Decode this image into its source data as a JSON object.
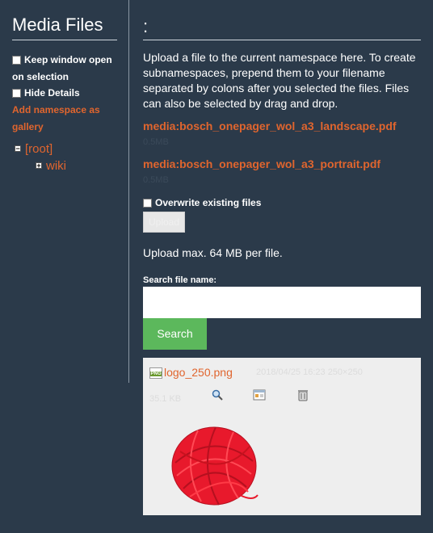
{
  "sidebar": {
    "title": "Media Files",
    "options": [
      {
        "label": "Keep window open on selection",
        "checked": false
      },
      {
        "label": "Hide Details",
        "checked": false
      }
    ],
    "add_namespace_link": "Add namespace as gallery",
    "tree": [
      {
        "label": "[root]",
        "expanded": true
      },
      {
        "label": "wiki",
        "expanded": false
      }
    ]
  },
  "main": {
    "heading": ":",
    "intro": "Upload a file to the current namespace here. To create subnamespaces, prepend them to your filename separated by colons after you selected the files. Files can also be selected by drag and drop.",
    "files": [
      {
        "name": "media:bosch_onepager_wol_a3_landscape.pdf",
        "size": "0.5MB"
      },
      {
        "name": "media:bosch_onepager_wol_a3_portrait.pdf",
        "size": "0.5MB"
      }
    ],
    "overwrite_label": "Overwrite existing files",
    "upload_button": "Upload",
    "max_size_text": "Upload max. 64 MB per file.",
    "search_label": "Search file name:",
    "search_value": "",
    "search_button": "Search",
    "media_item": {
      "filename": "logo_250.png",
      "meta_line1": "2018/04/25 16:23 250×250",
      "meta_line2": "35.1 KB",
      "file_type_badge": "PNG",
      "actions": [
        "magnifier-icon",
        "insert-icon",
        "delete-icon"
      ]
    }
  },
  "colors": {
    "background": "#2b3a4a",
    "link": "#e0652e",
    "search_button": "#5cb85c",
    "panel": "#eeeeee"
  }
}
